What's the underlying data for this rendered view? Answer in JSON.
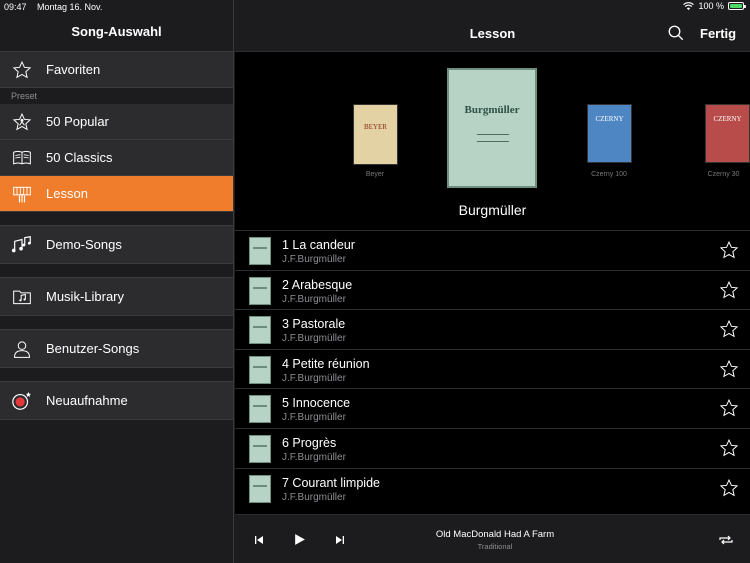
{
  "status": {
    "time": "09:47",
    "date": "Montag 16. Nov.",
    "battery": "100 %"
  },
  "sidebar": {
    "title": "Song-Auswahl",
    "favorites": "Favoriten",
    "section_preset": "Preset",
    "items": [
      {
        "label": "50 Popular",
        "icon": "star-person-icon"
      },
      {
        "label": "50 Classics",
        "icon": "book-icon"
      },
      {
        "label": "Lesson",
        "icon": "hand-icon",
        "active": true
      },
      {
        "label": "Demo-Songs",
        "icon": "music-notes-icon"
      },
      {
        "label": "Musik-Library",
        "icon": "folder-music-icon"
      },
      {
        "label": "Benutzer-Songs",
        "icon": "user-icon"
      },
      {
        "label": "Neuaufnahme",
        "icon": "record-icon"
      }
    ],
    "accent_color": "#f07d2b"
  },
  "main": {
    "title": "Lesson",
    "done_label": "Fertig",
    "featured_title": "Burgmüller",
    "books": [
      {
        "label": "Beyer",
        "cover": "BEYER",
        "color": "#e3d2a3"
      },
      {
        "label": "",
        "cover": "Burgmüller",
        "color": "#b7d3c6"
      },
      {
        "label": "Czerny 100",
        "cover": "CZERNY",
        "color": "#4e86c4"
      },
      {
        "label": "Czerny 30",
        "cover": "CZERNY",
        "color": "#b74c4a"
      }
    ],
    "songs": [
      {
        "title": "1 La candeur",
        "composer": "J.F.Burgmüller"
      },
      {
        "title": "2 Arabesque",
        "composer": "J.F.Burgmüller"
      },
      {
        "title": "3 Pastorale",
        "composer": "J.F.Burgmüller"
      },
      {
        "title": "4 Petite réunion",
        "composer": "J.F.Burgmüller"
      },
      {
        "title": "5 Innocence",
        "composer": "J.F.Burgmüller"
      },
      {
        "title": "6 Progrès",
        "composer": "J.F.Burgmüller"
      },
      {
        "title": "7 Courant limpide",
        "composer": "J.F.Burgmüller"
      }
    ]
  },
  "player": {
    "title": "Old MacDonald Had A Farm",
    "subtitle": "Traditional"
  }
}
